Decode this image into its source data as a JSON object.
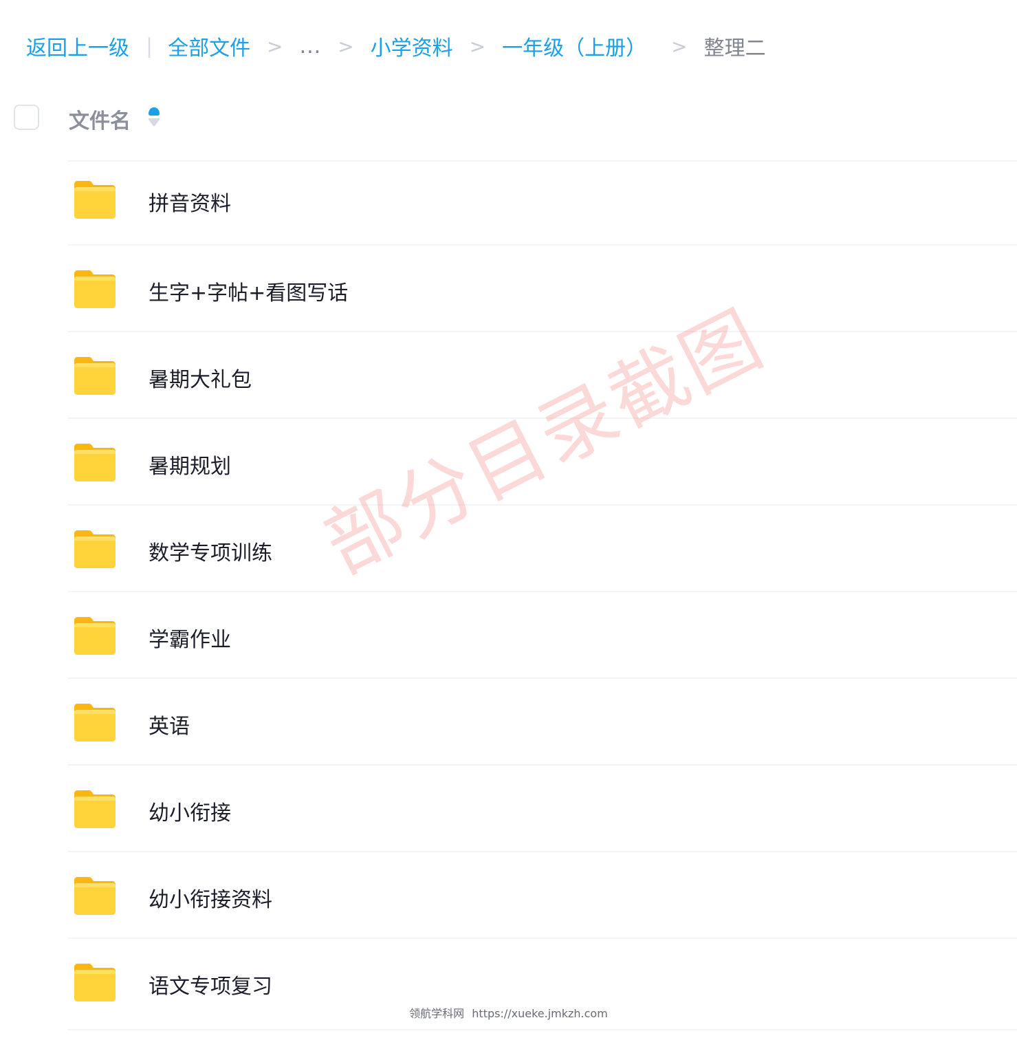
{
  "breadcrumb": {
    "back_label": "返回上一级",
    "divider": "|",
    "all_files_label": "全部文件",
    "separator": ">",
    "ellipsis": "...",
    "level1": "小学资料",
    "level2": "一年级（上册）",
    "current": "整理二"
  },
  "list_header": {
    "title": "文件名",
    "sort_icon": "sort-ascending-icon"
  },
  "files": [
    {
      "name": "拼音资料",
      "icon": "folder-icon"
    },
    {
      "name": "生字+字帖+看图写话",
      "icon": "folder-icon"
    },
    {
      "name": "暑期大礼包",
      "icon": "folder-icon"
    },
    {
      "name": "暑期规划",
      "icon": "folder-icon"
    },
    {
      "name": "数学专项训练",
      "icon": "folder-icon"
    },
    {
      "name": "学霸作业",
      "icon": "folder-icon"
    },
    {
      "name": "英语",
      "icon": "folder-icon"
    },
    {
      "name": "幼小衔接",
      "icon": "folder-icon"
    },
    {
      "name": "幼小衔接资料",
      "icon": "folder-icon"
    },
    {
      "name": "语文专项复习",
      "icon": "folder-icon"
    }
  ],
  "watermark": "部分目录截图",
  "footer": {
    "site_name": "领航学科网",
    "url": "https://xueke.jmkzh.com"
  },
  "colors": {
    "link": "#1aa0e8",
    "folder": "#ffd43b",
    "text": "#1b1e2a",
    "muted": "#80858f"
  }
}
